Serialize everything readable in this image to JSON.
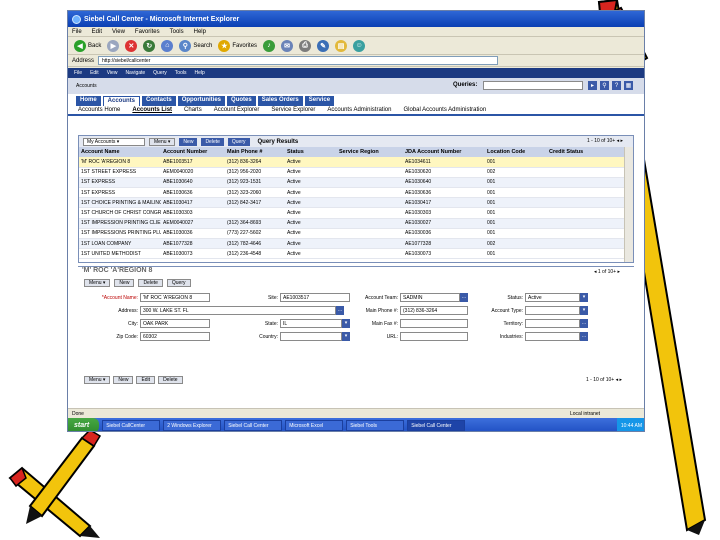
{
  "window": {
    "title": "Siebel Call Center - Microsoft Internet Explorer",
    "menu": [
      "File",
      "Edit",
      "View",
      "Favorites",
      "Tools",
      "Help"
    ],
    "toolbar": {
      "back": "Back",
      "search": "Search",
      "favorites": "Favorites"
    },
    "address_label": "Address",
    "address": "http://siebel/callcenter"
  },
  "siebel": {
    "top_menu": [
      "File",
      "Edit",
      "View",
      "Navigate",
      "Query",
      "Tools",
      "Help"
    ],
    "queries_label": "Queries:",
    "breadcrumb": "Accounts",
    "tabs": [
      "Home",
      "Accounts",
      "Contacts",
      "Opportunities",
      "Quotes",
      "Sales Orders",
      "Service"
    ],
    "subtabs": [
      "Accounts Home",
      "Accounts List",
      "Charts",
      "Account Explorer",
      "Service Explorer",
      "Accounts Administration",
      "Global Accounts Administration"
    ],
    "list": {
      "view_select": "My Accounts",
      "buttons": {
        "menu": "Menu",
        "new": "New",
        "delete": "Delete",
        "query": "Query"
      },
      "title": "Query Results",
      "pager": "1 - 10 of 10+",
      "columns": [
        "Account Name",
        "Account Number",
        "Main Phone #",
        "Status",
        "Service Region",
        "JDA Account Number",
        "Location Code",
        "Credit Status"
      ],
      "rows": [
        [
          "'M' ROC 'A'REGION 8",
          "ABE1003517",
          "(312) 836-3264",
          "Active",
          "",
          "AE1034611",
          "001",
          ""
        ],
        [
          "1ST STREET EXPRESS",
          "AEM0040020",
          "(312) 956-2020",
          "Active",
          "",
          "AE1030620",
          "002",
          ""
        ],
        [
          "1ST EXPRESS",
          "ABE1030640",
          "(312) 923-1531",
          "Active",
          "",
          "AE1030640",
          "001",
          ""
        ],
        [
          "1ST EXPRESS",
          "ABE1030636",
          "(312) 323-2060",
          "Active",
          "",
          "AE1030636",
          "001",
          ""
        ],
        [
          "1ST CHOICE PRINTING & MAILING INC",
          "ABE1030417",
          "(312) 842-3417",
          "Active",
          "",
          "AE1030417",
          "001",
          ""
        ],
        [
          "1ST CHURCH OF CHRIST CONGREGATIONAL",
          "ABE1030303",
          "",
          "Active",
          "",
          "AE1030303",
          "001",
          ""
        ],
        [
          "1ST IMPRESSION PRINTING CLIENT",
          "AEM0040027",
          "(312) 364-8693",
          "Active",
          "",
          "AE1030027",
          "001",
          ""
        ],
        [
          "1ST IMPRESSIONS PRINTING PLUS",
          "ABE1030036",
          "(773) 227-5602",
          "Active",
          "",
          "AE1030036",
          "001",
          ""
        ],
        [
          "1ST LOAN COMPANY",
          "ABE1077328",
          "(312) 782-4646",
          "Active",
          "",
          "AE1077328",
          "002",
          ""
        ],
        [
          "1ST UNITED METHODIST",
          "ABE1030073",
          "(312) 236-4548",
          "Active",
          "",
          "AE1030073",
          "001",
          ""
        ]
      ]
    },
    "form": {
      "title": "'M' ROC 'A'REGION 8",
      "pager": "1 of 10+",
      "buttons": {
        "menu": "Menu",
        "new": "New",
        "delete": "Delete",
        "query": "Query"
      },
      "fields": {
        "account_name": {
          "label": "*Account Name:",
          "value": "'M' ROC 'A'REGION 8"
        },
        "site": {
          "label": "Site:",
          "value": "AE1003517"
        },
        "account_team": {
          "label": "Account Team:",
          "value": "SADMIN"
        },
        "status": {
          "label": "Status:",
          "value": "Active"
        },
        "address": {
          "label": "Address:",
          "value": "300 W. LAKE ST. FL"
        },
        "main_phone": {
          "label": "Main Phone #:",
          "value": "(312) 836-3264"
        },
        "account_type": {
          "label": "Account Type:",
          "value": ""
        },
        "city": {
          "label": "City:",
          "value": "OAK PARK"
        },
        "state": {
          "label": "State:",
          "value": "IL"
        },
        "main_fax": {
          "label": "Main Fax #:",
          "value": ""
        },
        "territory": {
          "label": "Territory:",
          "value": ""
        },
        "zip": {
          "label": "Zip Code:",
          "value": "60302"
        },
        "country": {
          "label": "Country:",
          "value": ""
        },
        "url": {
          "label": "URL:",
          "value": ""
        },
        "industries": {
          "label": "Industries:",
          "value": ""
        }
      },
      "bottom_buttons": {
        "menu": "Menu",
        "new": "New",
        "edit": "Edit",
        "delete": "Delete"
      },
      "bottom_pager": "1 - 10 of 10+"
    }
  },
  "statusbar": {
    "text": "Done",
    "zone": "Local intranet"
  },
  "taskbar": {
    "start": "start",
    "items": [
      "Siebel CallCenter",
      "2 Windows Explorer",
      "Siebel Call Center",
      "Microsoft Excel",
      "Siebel Tools",
      "Siebel Call Center"
    ],
    "tray": "10:44 AM"
  },
  "colors": {
    "accent": "#2b55a6",
    "pencil_yellow": "#f2c40c",
    "pencil_tip": "#d8251f"
  }
}
